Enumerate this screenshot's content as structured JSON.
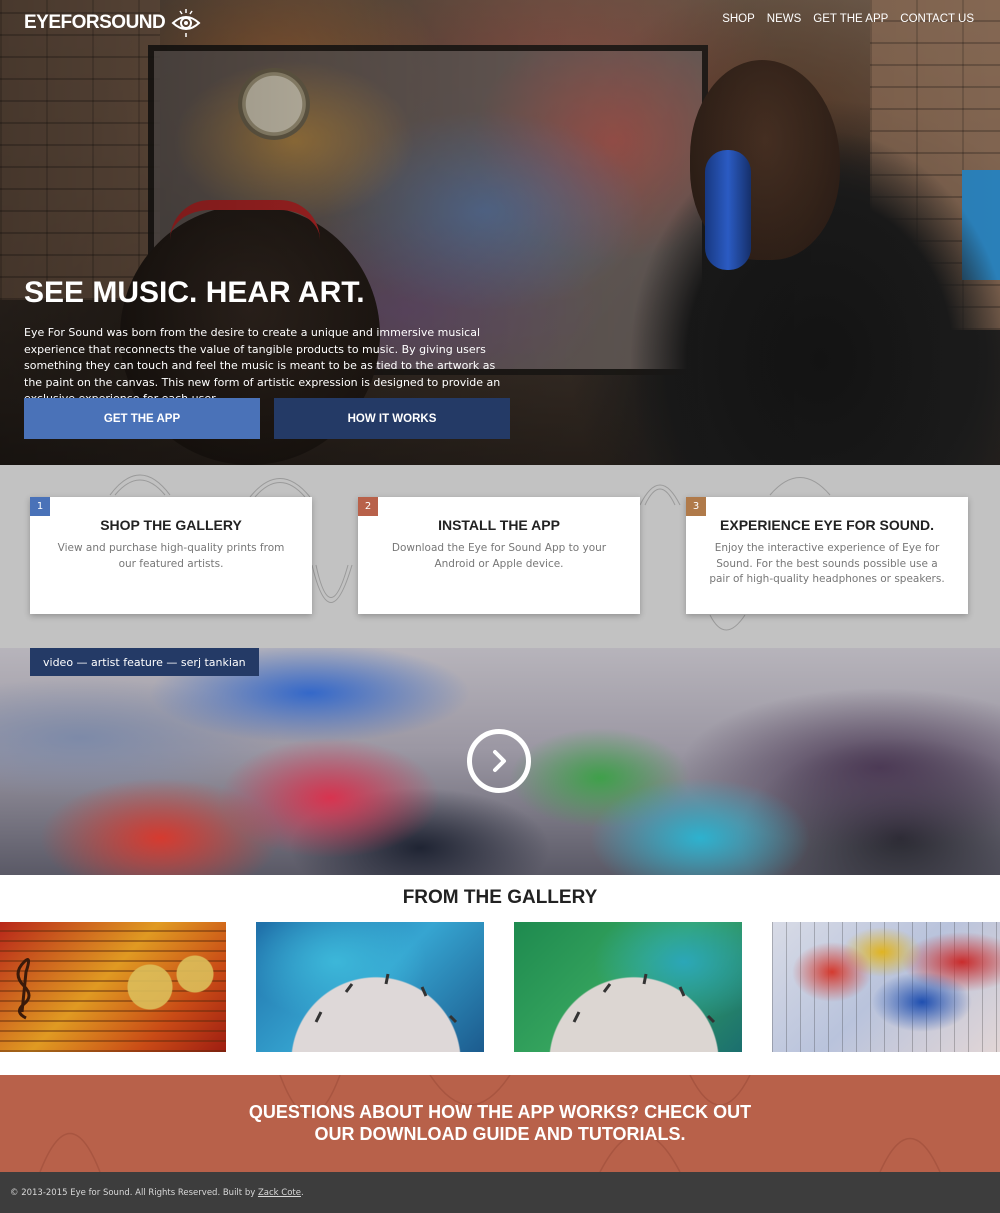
{
  "brand": {
    "logo_text": "EYEFORSOUND"
  },
  "nav": {
    "items": [
      "SHOP",
      "NEWS",
      "GET THE APP",
      "CONTACT US"
    ]
  },
  "hero": {
    "title": "SEE MUSIC. HEAR ART.",
    "body": "Eye For Sound was born from the desire to create a unique and immersive musical experience that reconnects the value of tangible products to music. By giving users something they can touch and feel the music is meant to be as tied to the artwork as the paint on the canvas. This new form of artistic expression is designed to provide an exclusive experience for each user.",
    "primary_button": "GET THE APP",
    "secondary_button": "HOW IT WORKS"
  },
  "steps": [
    {
      "number": "1",
      "title": "SHOP THE GALLERY",
      "text": "View and purchase high-quality prints from our featured artists.",
      "color": "#4a72b8"
    },
    {
      "number": "2",
      "title": "INSTALL THE APP",
      "text": "Download the Eye for Sound App to your Android or Apple device.",
      "color": "#b8614a"
    },
    {
      "number": "3",
      "title": "EXPERIENCE EYE FOR SOUND.",
      "text": "Enjoy the interactive experience of Eye for Sound. For the best sounds possible use a pair of high-quality headphones or speakers.",
      "color": "#b07a4a"
    }
  ],
  "video": {
    "label": "video — artist feature — serj tankian"
  },
  "gallery": {
    "title": "FROM THE GALLERY"
  },
  "cta": {
    "line1": "QUESTIONS ABOUT HOW THE APP WORKS? CHECK OUT",
    "line2": "OUR DOWNLOAD GUIDE AND TUTORIALS."
  },
  "footer": {
    "text": "© 2013-2015 Eye for Sound. All Rights Reserved. Built by",
    "link": "Zack Cote",
    "suffix": "."
  },
  "colors": {
    "blue": "#4a72b8",
    "navy": "#243a66",
    "rust": "#b8614a",
    "footer": "#3d3d3d"
  }
}
